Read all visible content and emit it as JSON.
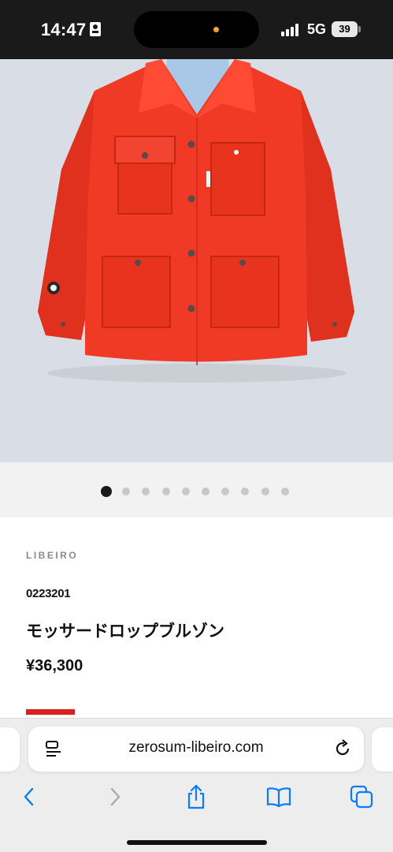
{
  "status_bar": {
    "time": "14:47",
    "network": "5G",
    "battery": "39",
    "icons": [
      "id-card-icon",
      "signal-icon",
      "battery-icon"
    ]
  },
  "product_image": {
    "alt_subject": "red-jacket-photo",
    "colors": {
      "background": "#d9dde5",
      "jacket": "#f13a26",
      "lining": "#a9c7e6"
    }
  },
  "carousel": {
    "total": 10,
    "active_index": 0
  },
  "product": {
    "brand": "LIBEIRO",
    "code": "0223201",
    "name": "モッサードロップブルゾン",
    "price": "¥36,300",
    "accent_color": "#d9201e"
  },
  "browser": {
    "url": "zerosum-libeiro.com",
    "toolbar": [
      "back-icon",
      "forward-icon",
      "share-icon",
      "bookmarks-icon",
      "tabs-icon"
    ],
    "accent_color": "#0a7aff"
  }
}
